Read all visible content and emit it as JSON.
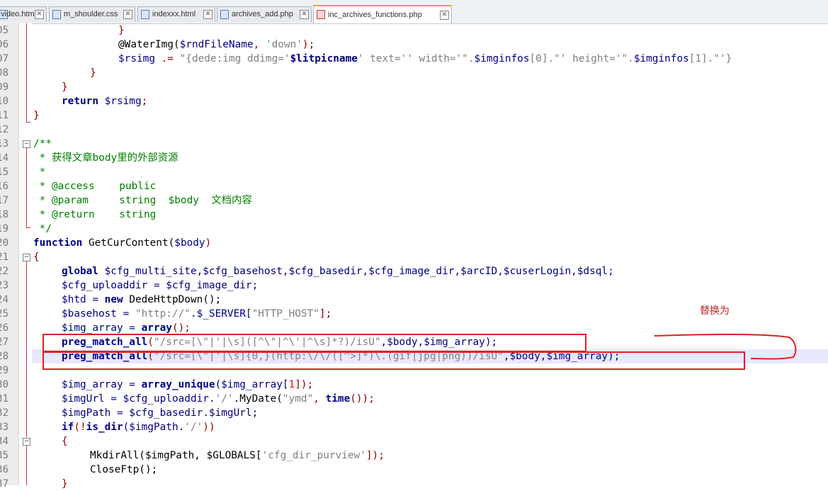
{
  "tabs": [
    {
      "label": "video.htm",
      "active": false
    },
    {
      "label": "m_shoulder.css",
      "active": false
    },
    {
      "label": "indexxx.html",
      "active": false
    },
    {
      "label": "archives_add.php",
      "active": false
    },
    {
      "label": "inc_archives_functions.php",
      "active": true
    }
  ],
  "line_numbers": [
    "05",
    "06",
    "07",
    "08",
    "09",
    "10",
    "11",
    "12",
    "13",
    "14",
    "15",
    "16",
    "17",
    "18",
    "19",
    "20",
    "21",
    "22",
    "23",
    "24",
    "25",
    "26",
    "27",
    "28",
    "29",
    "30",
    "31",
    "32",
    "33",
    "34",
    "35",
    "36",
    "37"
  ],
  "code": {
    "l05": "}",
    "l06_a": "@WaterImg(",
    "l06_b": "$rndFileName",
    "l06_c": ", ",
    "l06_d": "'down'",
    "l06_e": ");",
    "l07_a": "$rsimg",
    "l07_b": " .= ",
    "l07_c": "\"{dede:img ddimg='",
    "l07_d": "$litpicname",
    "l07_e": "' text='' width='\".",
    "l07_f": "$imginfos",
    "l07_g": "[0].\"' height='\".",
    "l07_h": "$imginfos",
    "l07_i": "[1].\"'}",
    "l08": "}",
    "l09": "}",
    "l10_a": "return",
    "l10_b": " $rsimg",
    "l10_c": ";",
    "l11": "}",
    "l13": "/**",
    "l14": " * 获得文章body里的外部资源",
    "l15": " *",
    "l16": " * @access    public",
    "l17": " * @param     string  $body  文档内容",
    "l18": " * @return    string",
    "l19": " */",
    "l20_a": "function",
    "l20_b": " GetCurContent(",
    "l20_c": "$body",
    "l20_d": ")",
    "l21": "{",
    "l22_a": "global",
    "l22_b": " $cfg_multi_site,$cfg_basehost,$cfg_basedir,$cfg_image_dir,$arcID,$cuserLogin,$dsql;",
    "l23": "$cfg_uploaddir = $cfg_image_dir;",
    "l24_a": "$htd = ",
    "l24_b": "new",
    "l24_c": " DedeHttpDown();",
    "l25_a": "$basehost = ",
    "l25_b": "\"http://\"",
    "l25_c": ".$_SERVER[",
    "l25_d": "\"HTTP_HOST\"",
    "l25_e": "];",
    "l26_a": "$img_array = ",
    "l26_b": "array",
    "l26_c": "();",
    "l27_a": "preg_match_all",
    "l27_b": "(",
    "l27_c": "\"/src=[\\\"|'|\\s]([^\\\"|^\\'|^\\s]*?)/isU\"",
    "l27_d": ",$body,$img_array);",
    "l28_a": "preg_match_all",
    "l28_b": "(",
    "l28_c": "\"/src=[\\\"|'|\\s]{0,}(http:\\/\\/([^>]*)\\.(gif|jpg|png))/isU\"",
    "l28_d": ",$body,$img_array);",
    "l30_a": "$img_array = ",
    "l30_b": "array_unique",
    "l30_c": "($img_array[",
    "l30_d": "1",
    "l30_e": "]);",
    "l31_a": "$imgUrl = $cfg_uploaddir.",
    "l31_b": "'/'",
    "l31_c": ".MyDate(",
    "l31_d": "\"ymd\"",
    "l31_e": ", ",
    "l31_f": "time",
    "l31_g": "());",
    "l32_a": "$imgPath = $cfg_basedir.$imgUrl;",
    "l33_a": "if",
    "l33_b": "(!",
    "l33_c": "is_dir",
    "l33_d": "($imgPath.",
    "l33_e": "'/'",
    "l33_f": "))",
    "l34": "{",
    "l35_a": "MkdirAll($imgPath, $GLOBALS[",
    "l35_b": "'cfg_dir_purview'",
    "l35_c": "]);",
    "l36": "CloseFtp();",
    "l37": "}"
  },
  "annotation": {
    "label": "替换为",
    "color": "#e02020"
  }
}
